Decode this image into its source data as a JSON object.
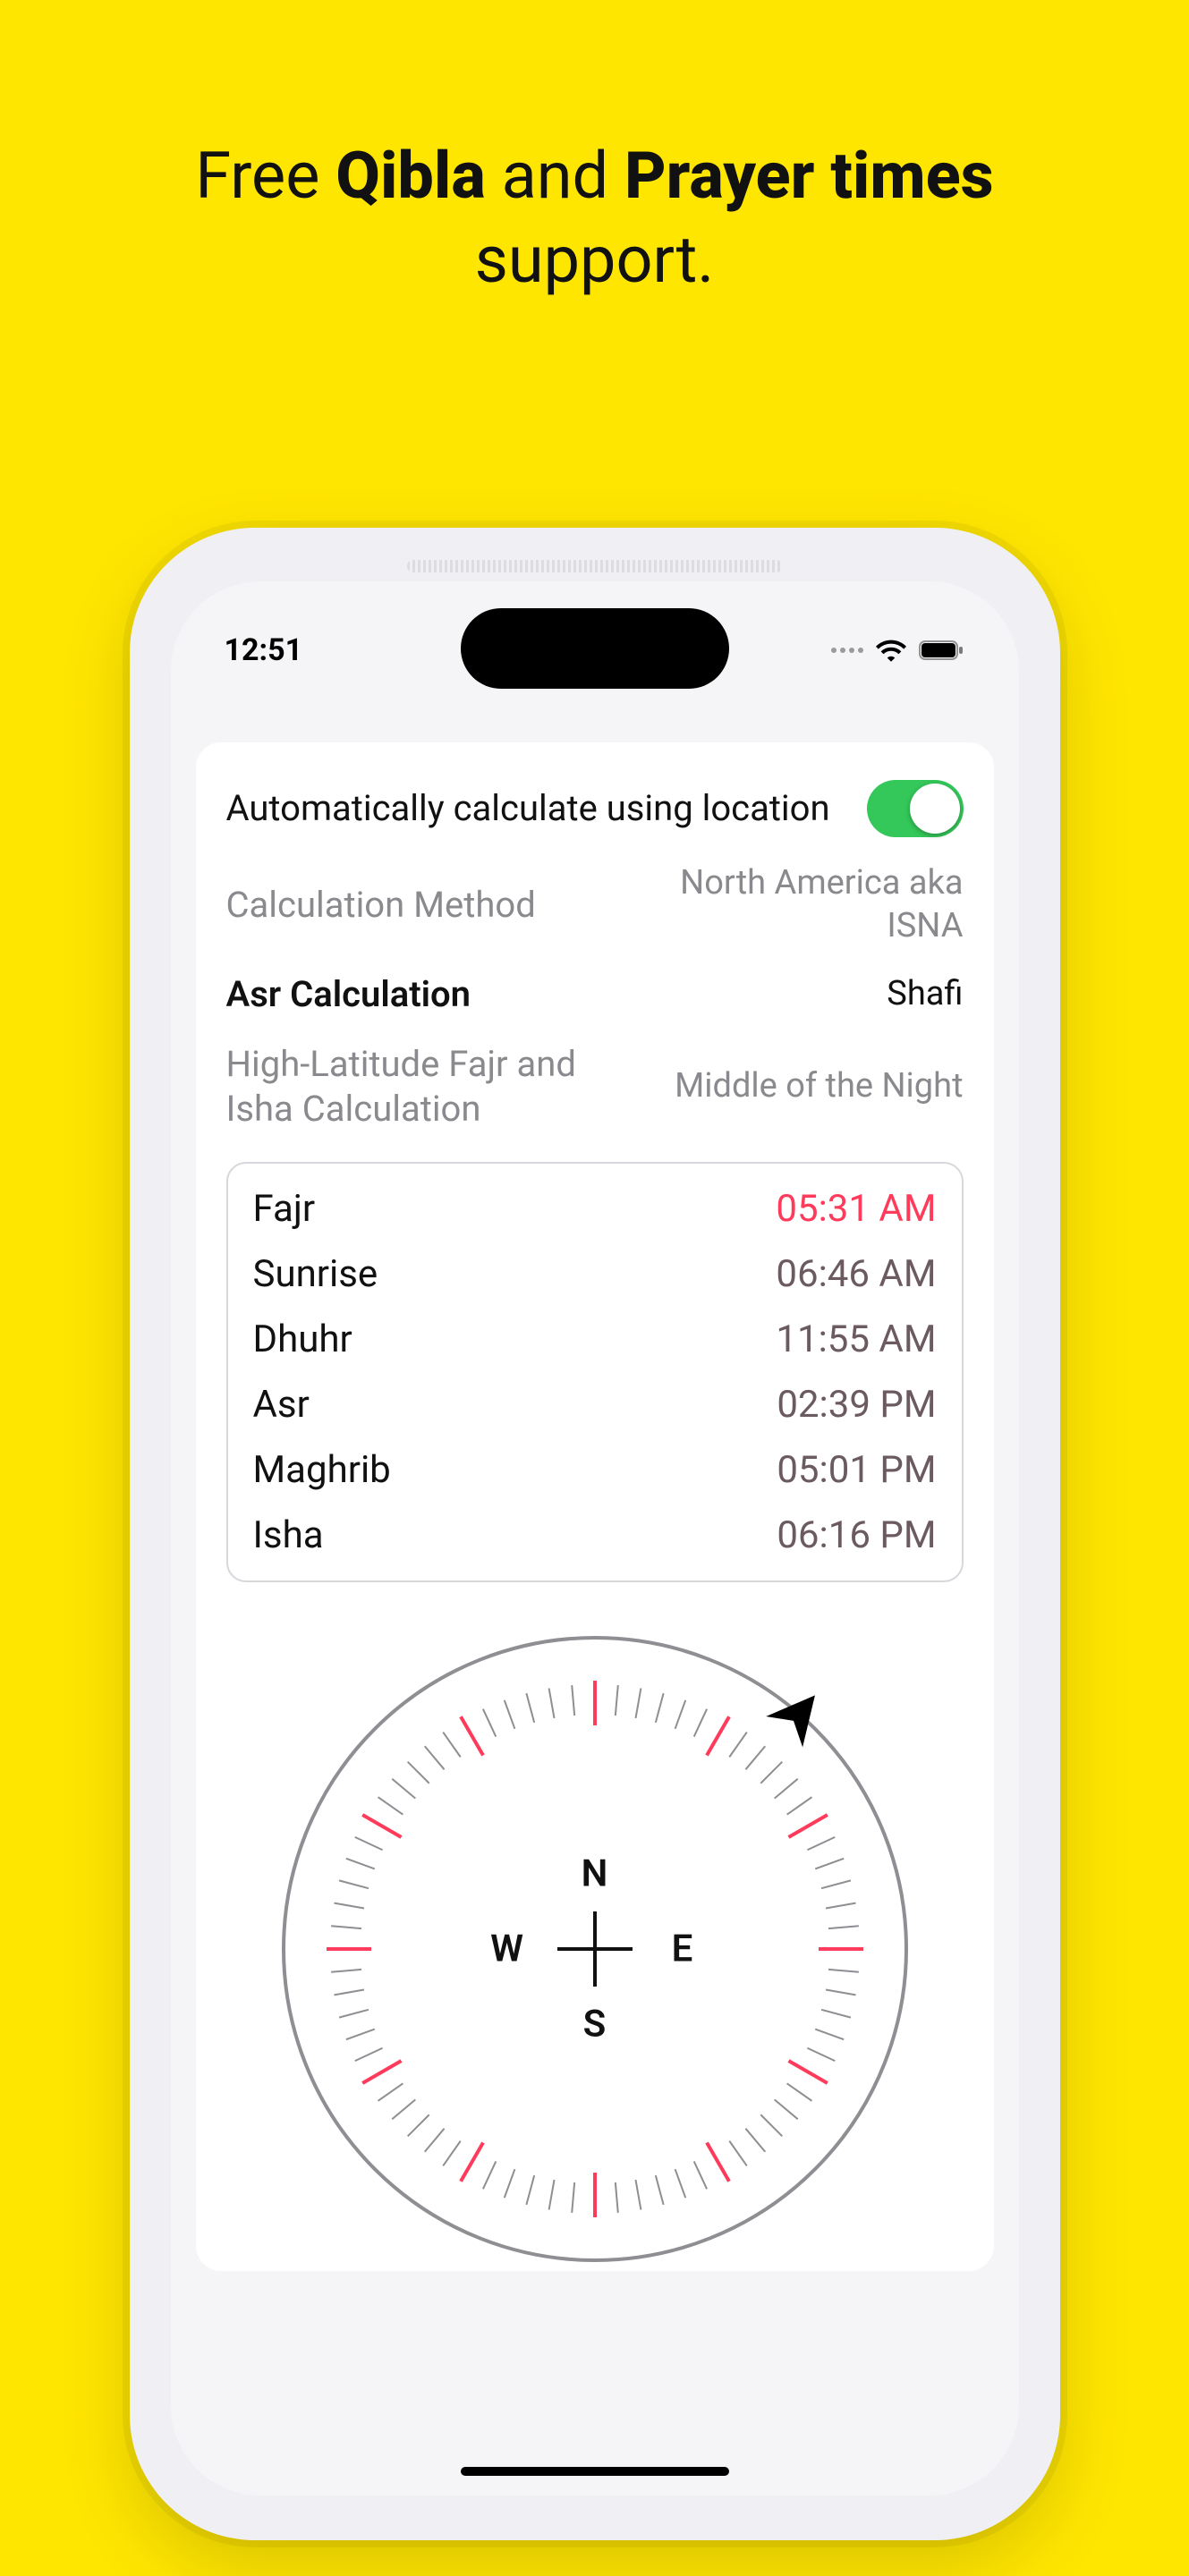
{
  "headline": {
    "pre": "Free ",
    "b1": "Qibla",
    "mid": " and ",
    "b2": "Prayer times",
    "post": " support."
  },
  "status": {
    "time": "12:51"
  },
  "settings": {
    "auto_label": "Automatically calculate using location",
    "auto_on": true,
    "calc_method_label": "Calculation Method",
    "calc_method_value": "North America aka ISNA",
    "asr_label": "Asr Calculation",
    "asr_value": "Shafi",
    "highlat_label": "High-Latitude Fajr and Isha Calculation",
    "highlat_value": "Middle of the Night"
  },
  "prayer_times": [
    {
      "name": "Fajr",
      "time": "05:31 AM",
      "active": true
    },
    {
      "name": "Sunrise",
      "time": "06:46 AM",
      "active": false
    },
    {
      "name": "Dhuhr",
      "time": "11:55 AM",
      "active": false
    },
    {
      "name": "Asr",
      "time": "02:39 PM",
      "active": false
    },
    {
      "name": "Maghrib",
      "time": "05:01 PM",
      "active": false
    },
    {
      "name": "Isha",
      "time": "06:16 PM",
      "active": false
    }
  ],
  "compass": {
    "N": "N",
    "S": "S",
    "E": "E",
    "W": "W",
    "qibla_bearing_deg": 40
  }
}
